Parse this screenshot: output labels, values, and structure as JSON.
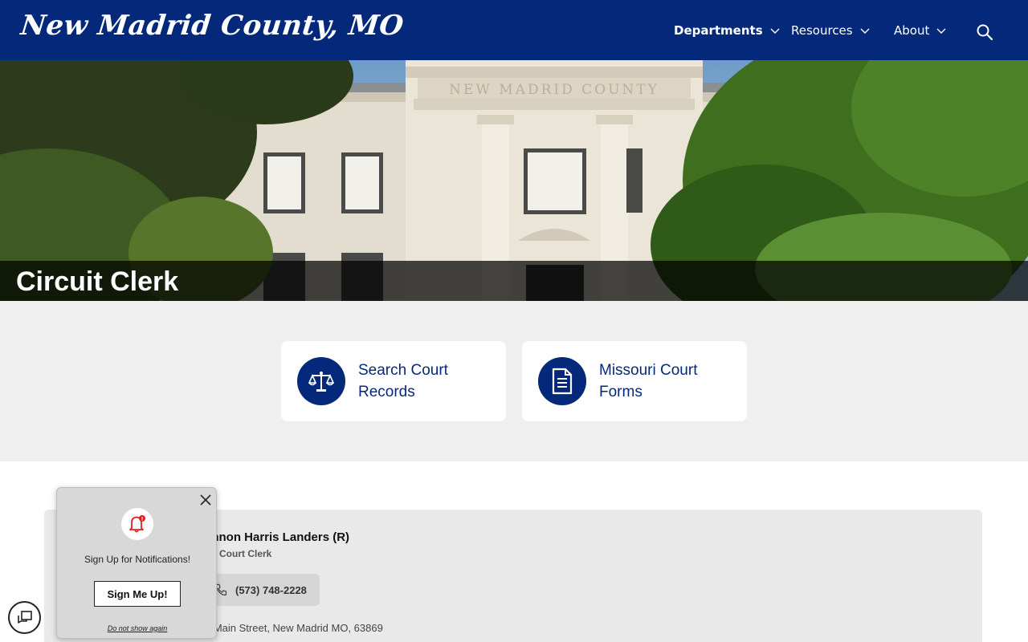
{
  "header": {
    "logo": "New Madrid County, MO",
    "nav": [
      {
        "label": "Departments"
      },
      {
        "label": "Resources"
      },
      {
        "label": "About"
      }
    ]
  },
  "hero": {
    "title": "Circuit Clerk",
    "building_inscription": "NEW MADRID COUNTY"
  },
  "quick_links": [
    {
      "label": "Search Court Records",
      "icon": "scales-icon"
    },
    {
      "label": "Missouri Court Forms",
      "icon": "document-icon"
    }
  ],
  "contact": {
    "name": "annon Harris Landers (R)",
    "role": "uit Court Clerk",
    "phone": "(573) 748-2228",
    "address": "0 Main Street, New Madrid MO, 63869"
  },
  "notification_popup": {
    "message": "Sign Up for Notifications!",
    "button": "Sign Me Up!",
    "dismiss": "Do not show again"
  },
  "colors": {
    "brand_navy": "#05297a",
    "quick_bg": "#efefef",
    "alert_red": "#e02020"
  }
}
